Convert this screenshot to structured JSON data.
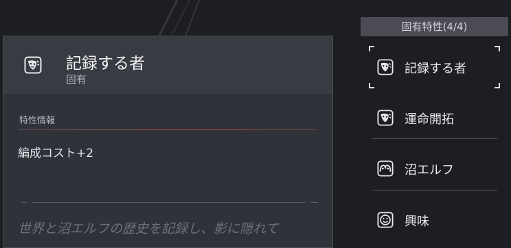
{
  "detail": {
    "title": "記録する者",
    "subtitle": "固有",
    "section_label": "特性情報",
    "effect": "編成コスト+2",
    "flavor": "世界と沼エルフの歴史を記録し、影に隠れて"
  },
  "traits_panel": {
    "header": "固有特性(4/4)",
    "items": [
      {
        "label": "記録する者",
        "icon": "mask-icon",
        "selected": true
      },
      {
        "label": "運命開拓",
        "icon": "mask-icon",
        "selected": false
      },
      {
        "label": "沼エルフ",
        "icon": "swamp-elf-icon",
        "selected": false
      },
      {
        "label": "興味",
        "icon": "smile-icon",
        "selected": false
      }
    ]
  },
  "colors": {
    "background": "#1d1e22",
    "panel": "#303239",
    "panel_header": "#393b43",
    "accent_line": "#b05050"
  }
}
